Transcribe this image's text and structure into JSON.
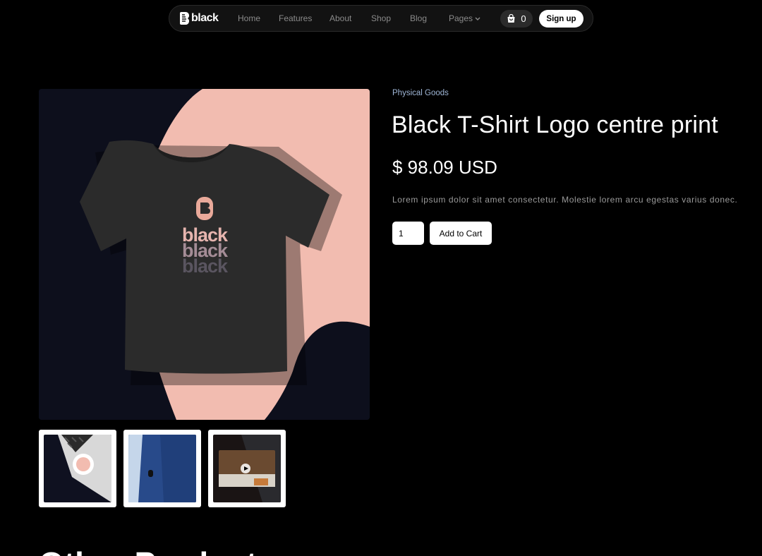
{
  "nav": {
    "logo_text": "black",
    "links": [
      {
        "label": "Home"
      },
      {
        "label": "Features"
      },
      {
        "label": "About"
      },
      {
        "label": "Shop"
      },
      {
        "label": "Blog"
      },
      {
        "label": "Pages"
      }
    ],
    "cart_icon": "shopping-bag-icon",
    "cart_count": "0",
    "signup_label": "Sign up"
  },
  "product": {
    "category": "Physical Goods",
    "title": "Black T-Shirt Logo centre print",
    "price": "$ 98.09 USD",
    "description": "Lorem ipsum dolor sit amet consectetur. Molestie lorem arcu egestas varius donec.",
    "quantity": "1",
    "add_to_cart_label": "Add to Cart",
    "shirt_print": [
      "black",
      "black",
      "black"
    ]
  },
  "thumbnails": [
    {
      "subject": "laptop with sticker"
    },
    {
      "subject": "man in blazer with pin"
    },
    {
      "subject": "video"
    }
  ],
  "other_products_heading": "Other Products",
  "colors": {
    "background": "#000000",
    "pink": "#f2bcb0",
    "navy": "#0d0f1c",
    "category_blue": "#9fb6d6"
  }
}
